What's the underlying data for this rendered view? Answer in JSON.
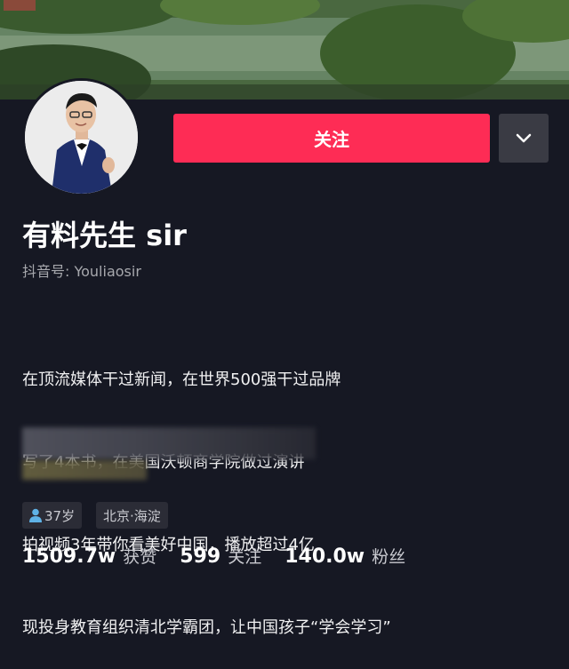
{
  "header": {
    "follow_label": "关注"
  },
  "profile": {
    "name": "有料先生 sir",
    "douyin_id": "抖音号: Youliaosir",
    "bio_lines": [
      "在顶流媒体干过新闻，在世界500强干过品牌",
      "写了4本书，在美国沃顿商学院做过演讲",
      "拍视频3年带你看美好中国，播放超过4亿",
      "现投身教育组织清北学霸团，让中国孩子“学会学习”"
    ],
    "tags": {
      "age": "37岁",
      "location": "北京·海淀"
    }
  },
  "stats": [
    {
      "value": "1509.7w",
      "label": "获赞"
    },
    {
      "value": "599",
      "label": "关注"
    },
    {
      "value": "140.0w",
      "label": "粉丝"
    }
  ],
  "colors": {
    "accent": "#fe2c55",
    "background": "#161823",
    "secondary_button": "#3a3b44"
  },
  "icons": {
    "more": "chevron-down-icon",
    "age": "person-icon"
  }
}
